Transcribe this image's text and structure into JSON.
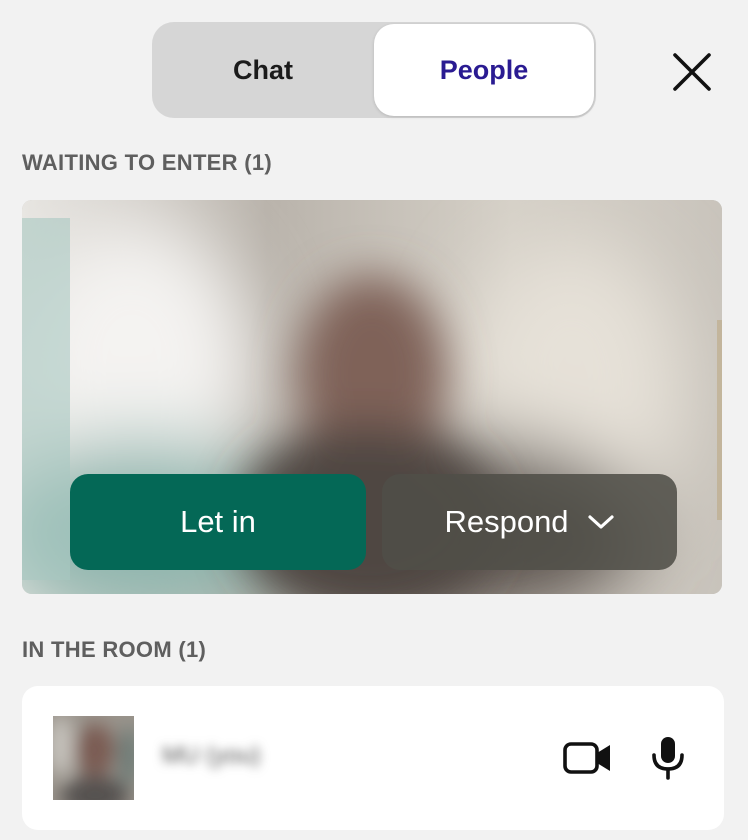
{
  "tabs": {
    "chat_label": "Chat",
    "people_label": "People",
    "active": "People"
  },
  "close": {
    "icon": "close-icon"
  },
  "waiting": {
    "heading": "WAITING TO ENTER (1)",
    "let_in_label": "Let in",
    "respond_label": "Respond",
    "respond_icon": "chevron-down-icon"
  },
  "room": {
    "heading": "IN THE ROOM (1)",
    "participant_name": "MU (you)",
    "camera_icon": "video-camera-icon",
    "mic_icon": "microphone-icon"
  },
  "colors": {
    "accent": "#2a1b92",
    "let_in": "#046856",
    "background": "#f2f2f2"
  }
}
